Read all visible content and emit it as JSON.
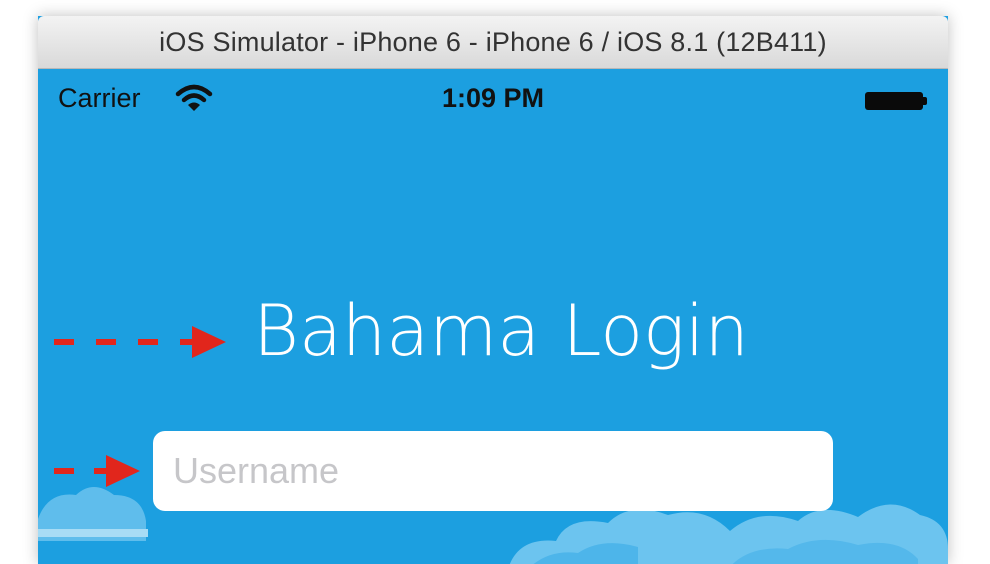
{
  "window": {
    "title": "iOS Simulator - iPhone 6 - iPhone 6 / iOS 8.1 (12B411)"
  },
  "status_bar": {
    "carrier": "Carrier",
    "wifi_icon": "wifi-icon",
    "time": "1:09 PM",
    "battery_icon": "battery-icon"
  },
  "app": {
    "title": "Bahama Login",
    "username_placeholder": "Username",
    "username_value": ""
  },
  "annotations": {
    "arrow_icon": "dashed-arrow-icon",
    "arrow_color": "#e1261c"
  },
  "colors": {
    "background": "#1c9fe0",
    "cloud": "#62c0ee"
  }
}
